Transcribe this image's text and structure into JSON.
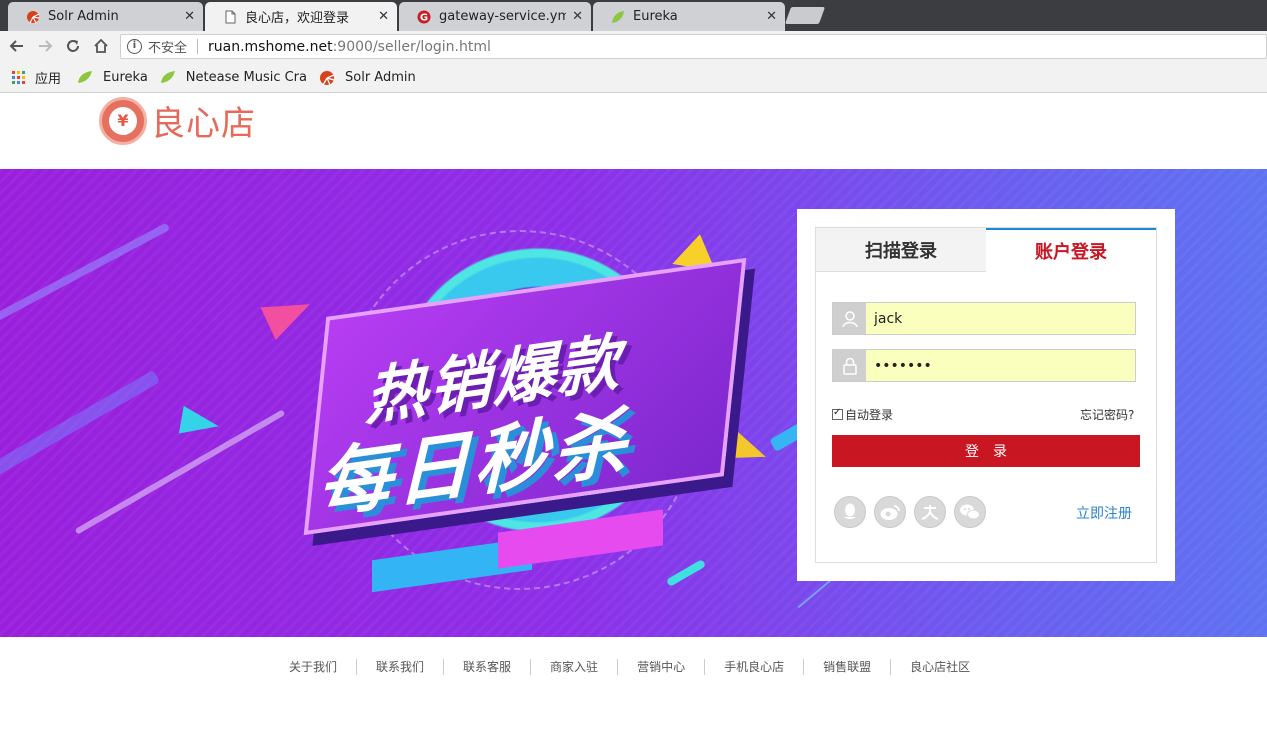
{
  "browser": {
    "tabs": [
      {
        "title": "Solr Admin",
        "active": false
      },
      {
        "title": "良心店，欢迎登录",
        "active": true
      },
      {
        "title": "gateway-service.yml · k",
        "active": false
      },
      {
        "title": "Eureka",
        "active": false
      }
    ],
    "tab_close": "✕",
    "address": {
      "insecure_label": "不安全",
      "host": "ruan.mshome.net",
      "path": ":9000/seller/login.html"
    },
    "bookmarks": [
      {
        "label": "应用",
        "icon": "apps-icon"
      },
      {
        "label": "Eureka",
        "icon": "leaf-icon"
      },
      {
        "label": "Netease Music Cra",
        "icon": "leaf-icon"
      },
      {
        "label": "Solr Admin",
        "icon": "solr-icon"
      }
    ]
  },
  "header": {
    "logo_symbol": "¥",
    "logo_text": "良心店"
  },
  "banner": {
    "headline_1": "热销爆款",
    "headline_2": "每日秒杀"
  },
  "login": {
    "tab_qr": "扫描登录",
    "tab_account": "账户登录",
    "username_value": "jack",
    "password_value": "•••••••",
    "remember_label": "自动登录",
    "remember_checked": true,
    "forgot_label": "忘记密码?",
    "submit_label": "登录",
    "register_label": "立即注册",
    "social": [
      "qq-icon",
      "weibo-icon",
      "renren-icon",
      "wechat-icon"
    ],
    "accent_color": "#c81623",
    "link_color": "#2a84c8"
  },
  "footer": {
    "links": [
      "关于我们",
      "联系我们",
      "联系客服",
      "商家入驻",
      "营销中心",
      "手机良心店",
      "销售联盟",
      "良心店社区"
    ]
  }
}
